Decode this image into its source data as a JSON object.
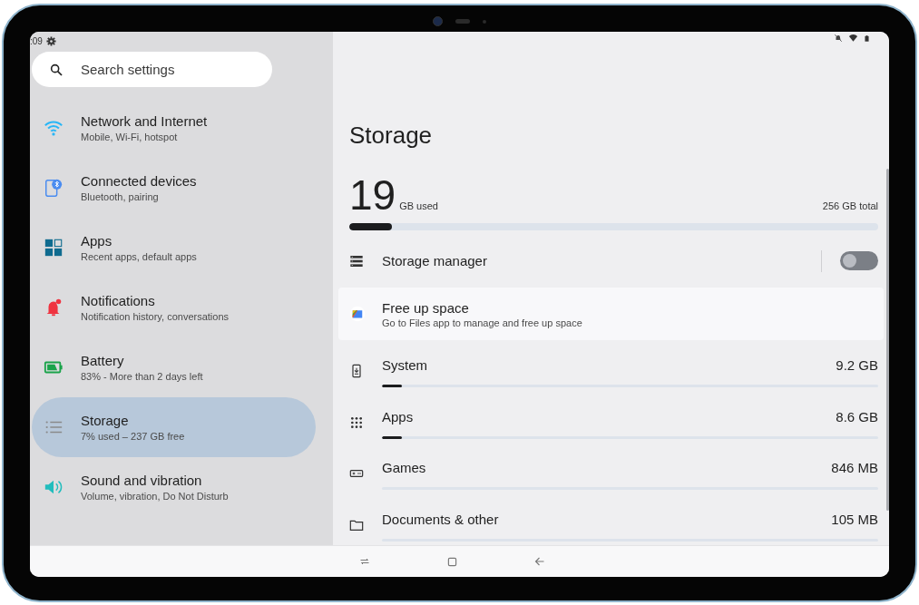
{
  "status_bar": {
    "time": ":09"
  },
  "search": {
    "placeholder": "Search settings"
  },
  "sidebar": {
    "items": [
      {
        "title": "Network and Internet",
        "subtitle": "Mobile, Wi-Fi, hotspot",
        "selected": false
      },
      {
        "title": "Connected devices",
        "subtitle": "Bluetooth, pairing",
        "selected": false
      },
      {
        "title": "Apps",
        "subtitle": "Recent apps, default apps",
        "selected": false
      },
      {
        "title": "Notifications",
        "subtitle": "Notification history, conversations",
        "selected": false
      },
      {
        "title": "Battery",
        "subtitle": "83% - More than 2 days left",
        "selected": false
      },
      {
        "title": "Storage",
        "subtitle": "7% used – 237 GB free",
        "selected": true
      },
      {
        "title": "Sound and vibration",
        "subtitle": "Volume, vibration, Do Not Disturb",
        "selected": false
      }
    ]
  },
  "page": {
    "title": "Storage",
    "used_amount": "19",
    "used_unit": "GB used",
    "total": "256 GB total",
    "level": 0.08
  },
  "storage_manager": {
    "label": "Storage manager",
    "on": false
  },
  "free_up": {
    "title": "Free up space",
    "subtitle": "Go to Files app to manage and free up space"
  },
  "categories": [
    {
      "name": "System",
      "size": "9.2 GB",
      "level": 0.04
    },
    {
      "name": "Apps",
      "size": "8.6 GB",
      "level": 0.04
    },
    {
      "name": "Games",
      "size": "846 MB",
      "level": 0
    },
    {
      "name": "Documents & other",
      "size": "105 MB",
      "level": 0
    }
  ]
}
